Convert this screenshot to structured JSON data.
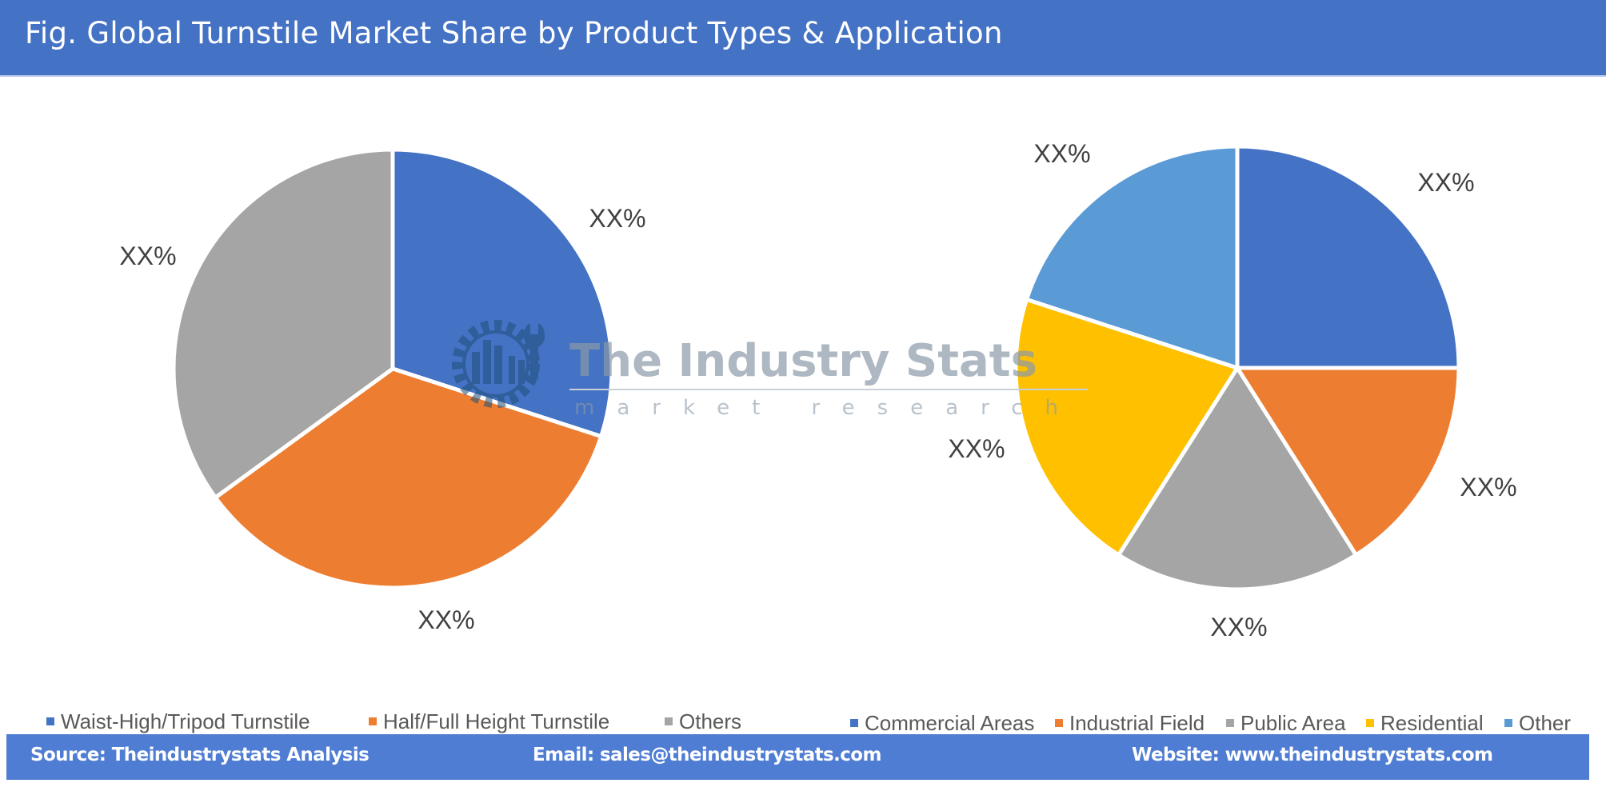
{
  "header": {
    "title": "Fig. Global Turnstile Market Share by Product Types & Application"
  },
  "chart_data": [
    {
      "type": "pie",
      "title": "Product Types",
      "categories": [
        "Waist-High/Tripod Turnstile",
        "Half/Full Height Turnstile",
        "Others"
      ],
      "values": [
        30,
        35,
        35
      ],
      "data_labels": [
        "XX%",
        "XX%",
        "XX%"
      ],
      "colors": [
        "#4472c4",
        "#ed7d31",
        "#a5a5a5"
      ],
      "start_angle_deg": 0,
      "direction": "clockwise",
      "legend_position": "bottom"
    },
    {
      "type": "pie",
      "title": "Application",
      "categories": [
        "Commercial Areas",
        "Industrial Field",
        "Public Area",
        "Residential",
        "Other"
      ],
      "values": [
        25,
        16,
        18,
        21,
        20
      ],
      "data_labels": [
        "XX%",
        "XX%",
        "XX%",
        "XX%",
        "XX%"
      ],
      "colors": [
        "#4472c4",
        "#ed7d31",
        "#a5a5a5",
        "#ffc000",
        "#5b9bd5"
      ],
      "start_angle_deg": 0,
      "direction": "clockwise",
      "legend_position": "bottom"
    }
  ],
  "watermark": {
    "title": "The Industry Stats",
    "subtitle": "market research",
    "logo_icon": "gear-wrench-factory-icon"
  },
  "footer": {
    "source": "Source: Theindustrystats Analysis",
    "email": "Email: sales@theindustrystats.com",
    "website": "Website: www.theindustrystats.com"
  }
}
